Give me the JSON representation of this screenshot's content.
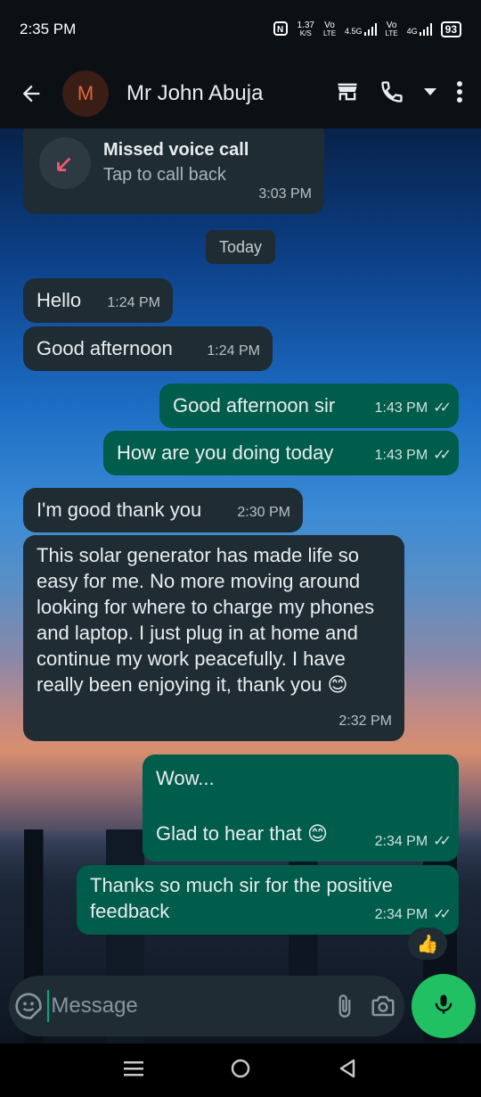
{
  "status_bar": {
    "time": "2:35 PM",
    "net_speed_top": "1.37",
    "net_speed_unit": "K/S",
    "sim1_top": "Vo",
    "sim1_bottom": "LTE",
    "sim1_gen": "4.5G",
    "sim2_top": "Vo",
    "sim2_bottom": "LTE",
    "sim2_gen": "4G",
    "battery": "93",
    "icons": [
      "nfc-icon",
      "signal-icon",
      "signal-icon",
      "battery-icon"
    ]
  },
  "header": {
    "avatar_letter": "M",
    "contact_name": "Mr John Abuja",
    "icons": [
      "back-arrow-icon",
      "store-icon",
      "phone-icon",
      "dropdown-icon",
      "more-vertical-icon"
    ]
  },
  "missed_call": {
    "title": "Missed voice call",
    "subtitle": "Tap to call back",
    "time": "3:03 PM"
  },
  "date_separator": "Today",
  "messages": [
    {
      "dir": "in",
      "text": "Hello",
      "time": "1:24 PM"
    },
    {
      "dir": "in",
      "text": "Good afternoon",
      "time": "1:24 PM"
    },
    {
      "dir": "out",
      "text": "Good afternoon sir",
      "time": "1:43 PM",
      "ticks": "✓✓"
    },
    {
      "dir": "out",
      "text": "How are you doing today",
      "time": "1:43 PM",
      "ticks": "✓✓"
    },
    {
      "dir": "in",
      "text": "I'm good thank you",
      "time": "2:30 PM"
    },
    {
      "dir": "in",
      "text": "This solar generator has made life so easy for me. No more moving around looking for where to charge my phones and laptop. I just plug in at home and continue my work peacefully. I have really been enjoying it, thank you 😊",
      "time": "2:32 PM"
    },
    {
      "dir": "out",
      "text": "Wow...",
      "text2": "Glad to hear that 😊",
      "time": "2:34 PM",
      "ticks": "✓✓"
    },
    {
      "dir": "out",
      "text": "Thanks so much sir for the positive feedback",
      "time": "2:34 PM",
      "ticks": "✓✓",
      "reaction": "👍"
    }
  ],
  "composer": {
    "placeholder": "Message",
    "icons": [
      "sticker-icon",
      "attach-icon",
      "camera-icon",
      "mic-icon"
    ]
  },
  "nav": {
    "icons": [
      "recents-icon",
      "home-icon",
      "back-icon"
    ]
  },
  "colors": {
    "incoming_bubble": "#1f2c33",
    "outgoing_bubble": "#005c4b",
    "accent_green": "#21c063",
    "header_bg": "#0b1014"
  }
}
